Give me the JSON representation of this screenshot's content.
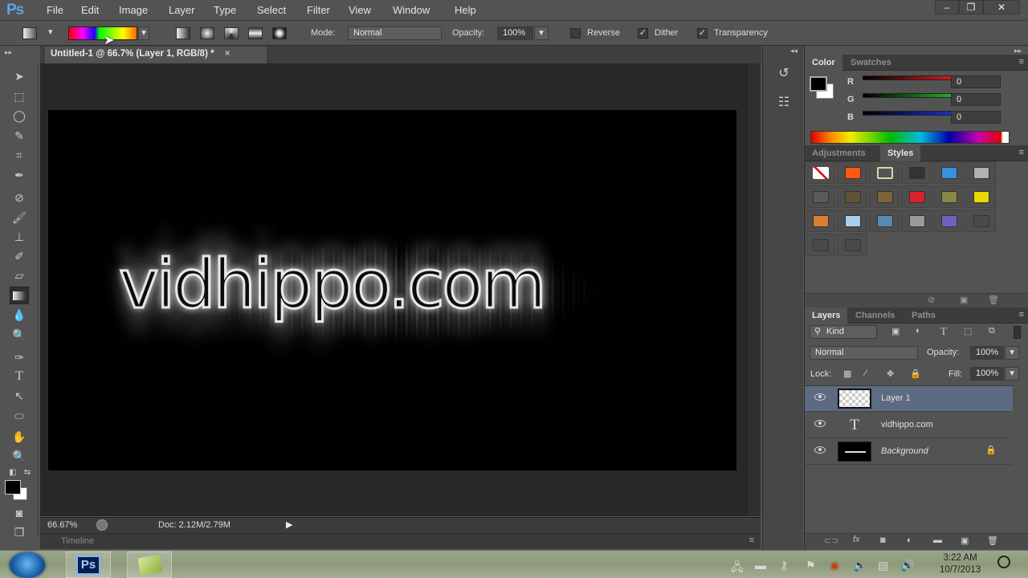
{
  "app": {
    "logo": "Ps"
  },
  "menu": [
    "File",
    "Edit",
    "Image",
    "Layer",
    "Type",
    "Select",
    "Filter",
    "View",
    "Window",
    "Help"
  ],
  "window_controls": {
    "minimize": "–",
    "restore": "❐",
    "close": "✕"
  },
  "options_bar": {
    "mode_label": "Mode:",
    "mode_value": "Normal",
    "opacity_label": "Opacity:",
    "opacity_value": "100%",
    "reverse_label": "Reverse",
    "reverse_checked": false,
    "dither_label": "Dither",
    "dither_checked": true,
    "transparency_label": "Transparency",
    "transparency_checked": true,
    "gradient_types": [
      "linear",
      "radial",
      "angle",
      "reflected",
      "diamond"
    ]
  },
  "document": {
    "tab_title": "Untitled-1 @ 66.7% (Layer 1, RGB/8) *",
    "close_glyph": "×",
    "canvas_text": "vidhippo.com"
  },
  "status": {
    "zoom": "66.67%",
    "doc_size": "Doc: 2.12M/2.79M",
    "timeline_label": "Timeline"
  },
  "tools": [
    "move",
    "rectangular-marquee",
    "lasso",
    "quick-selection",
    "crop",
    "eyedropper",
    "spot-healing",
    "brush",
    "clone-stamp",
    "history-brush",
    "eraser",
    "gradient",
    "blur",
    "dodge",
    "pen",
    "type",
    "path-selection",
    "ellipse",
    "hand",
    "zoom"
  ],
  "color_panel": {
    "tabs": [
      "Color",
      "Swatches"
    ],
    "active_tab": "Color",
    "channels": [
      {
        "label": "R",
        "value": "0",
        "color": "#e02020"
      },
      {
        "label": "G",
        "value": "0",
        "color": "#20c020"
      },
      {
        "label": "B",
        "value": "0",
        "color": "#2030e0"
      }
    ],
    "foreground": "#000000",
    "background": "#ffffff"
  },
  "styles_panel": {
    "tabs": [
      "Adjustments",
      "Styles"
    ],
    "active_tab": "Styles",
    "swatches": [
      "none",
      "#ff5a10",
      "#555555",
      "#333333",
      "#3a90e0",
      "#b0b0b0",
      "#5a5a5a",
      "#5f5436",
      "#7a6438",
      "#d82030",
      "#888844",
      "#e8d800",
      "#d88030",
      "#a8d0f0",
      "#5a8ab0",
      "#9a9a9a",
      "#7060c0",
      "#4a4a4a",
      "#4a4a4a",
      "#4a4a4a"
    ]
  },
  "layers_panel": {
    "tabs": [
      "Layers",
      "Channels",
      "Paths"
    ],
    "active_tab": "Layers",
    "filter_label": "Kind",
    "blend_mode": "Normal",
    "opacity_label": "Opacity:",
    "opacity_value": "100%",
    "lock_label": "Lock:",
    "fill_label": "Fill:",
    "fill_value": "100%",
    "layers": [
      {
        "name": "Layer 1",
        "type": "pixel",
        "selected": true,
        "visible": true
      },
      {
        "name": "vidhippo.com",
        "type": "text",
        "selected": false,
        "visible": true
      },
      {
        "name": "Background",
        "type": "background",
        "selected": false,
        "visible": true,
        "locked": true
      }
    ]
  },
  "taskbar": {
    "apps": [
      "Ps"
    ],
    "time": "3:22 AM",
    "date": "10/7/2013"
  }
}
